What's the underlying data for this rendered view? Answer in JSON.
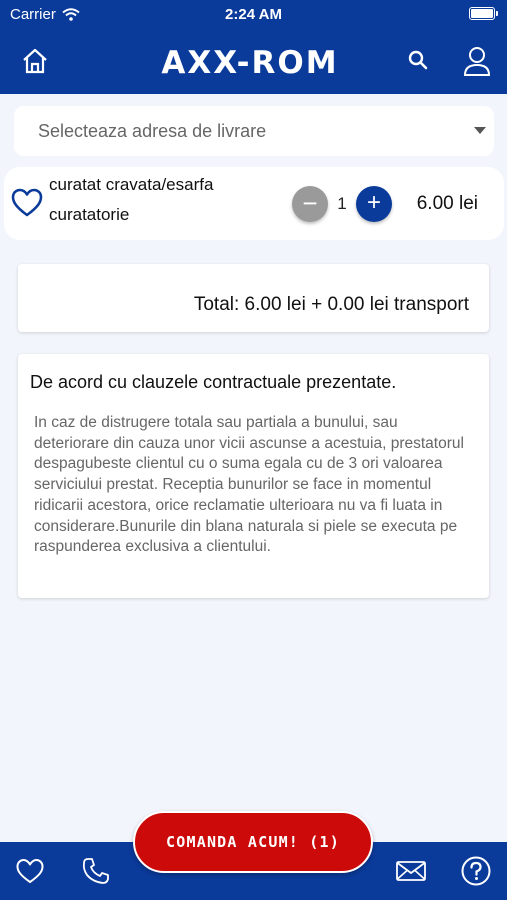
{
  "status_bar": {
    "carrier": "Carrier",
    "time": "2:24 AM"
  },
  "header": {
    "logo": "AXX-ROM",
    "icons": [
      "home-icon",
      "search-icon",
      "user-icon"
    ]
  },
  "address_select": {
    "placeholder": "Selecteaza adresa de livrare"
  },
  "cart_item": {
    "name": "curatat cravata/esarfa",
    "category": "curatatorie",
    "quantity": "1",
    "minus_label": "−",
    "plus_label": "+",
    "price": "6.00 lei"
  },
  "total": {
    "text": "Total: 6.00 lei + 0.00 lei transport"
  },
  "terms": {
    "title": "De acord cu clauzele contractuale prezentate.",
    "body": "In caz de distrugere totala sau partiala a bunului, sau deteriorare din cauza unor vicii ascunse a acestuia, prestatorul despagubeste clientul cu o suma egala cu de 3 ori valoarea serviciului prestat. Receptia bunurilor se face in momentul ridicarii acestora, orice reclamatie ulterioara nu va fi luata in considerare.Bunurile din blana naturala si piele se executa pe raspunderea exclusiva a clientului."
  },
  "order_button": {
    "label": "COMANDA ACUM! (1)"
  },
  "bottom_bar": {
    "icons": [
      "heart-icon",
      "phone-icon",
      "mail-icon",
      "help-icon"
    ]
  },
  "colors": {
    "brand_blue": "#0a3a9a",
    "order_red": "#cc0a0a",
    "background": "#f2f5fb"
  }
}
